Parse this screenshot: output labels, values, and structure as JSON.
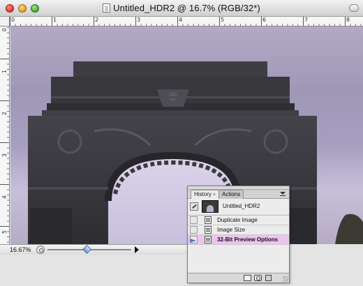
{
  "window": {
    "title": "Untitled_HDR2 @ 16.7% (RGB/32*)"
  },
  "rulers": {
    "top_labels": [
      "0",
      "1",
      "2",
      "3",
      "4",
      "5",
      "6",
      "7",
      "8"
    ],
    "left_labels": [
      "0",
      "1",
      "2",
      "3",
      "4",
      "5"
    ]
  },
  "statusbar": {
    "zoom": "16.67%"
  },
  "history_panel": {
    "tabs": [
      {
        "label": "History",
        "close": "×",
        "active": true
      },
      {
        "label": "Actions",
        "active": false
      }
    ],
    "snapshot": {
      "label": "Untitled_HDR2"
    },
    "items": [
      {
        "label": "Duplicate Image",
        "icon": "document-icon"
      },
      {
        "label": "Image Size",
        "icon": "document-icon"
      },
      {
        "label": "32-Bit Preview Options",
        "icon": "document-icon",
        "selected": true
      }
    ],
    "bottom_icons": [
      "new-document-icon",
      "snapshot-camera-icon",
      "trash-icon"
    ]
  },
  "colors": {
    "selection_highlight": "#efc3f0",
    "sky": "#a79fc0",
    "arch_stone": "#3b3a3f"
  }
}
